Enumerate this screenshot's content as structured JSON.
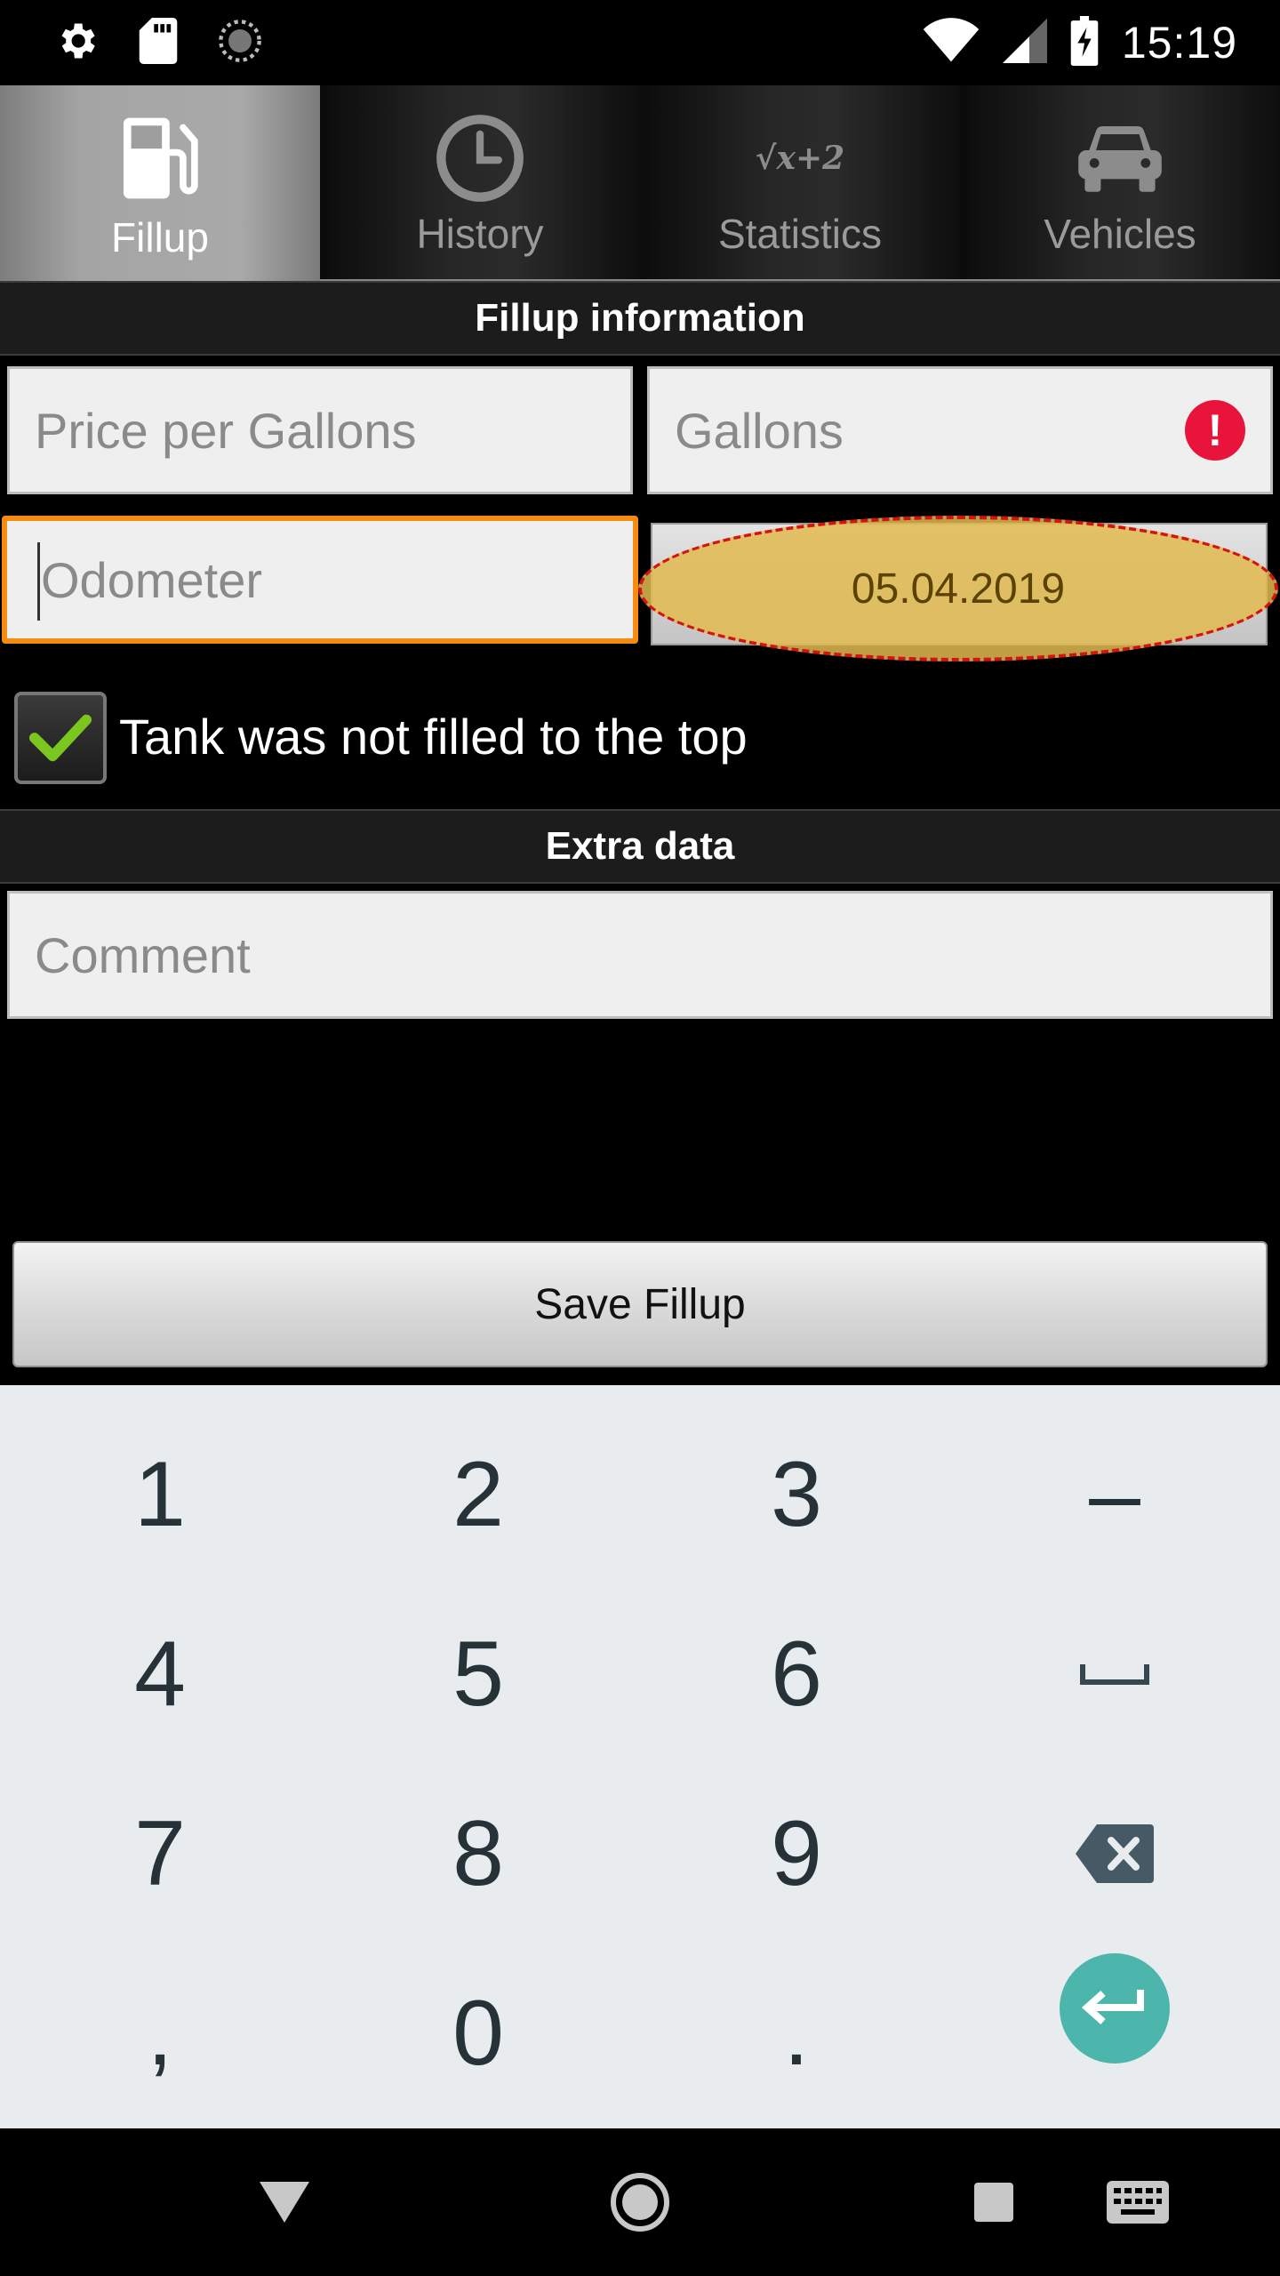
{
  "status_bar": {
    "time": "15:19",
    "icons": [
      "settings-icon",
      "sd-card-icon",
      "loading-icon",
      "wifi-icon",
      "signal-icon",
      "battery-charging-icon"
    ]
  },
  "tabs": [
    {
      "label": "Fillup",
      "icon": "fuel-pump-icon",
      "active": true
    },
    {
      "label": "History",
      "icon": "clock-icon",
      "active": false
    },
    {
      "label": "Statistics",
      "icon": "formula-icon",
      "icon_text": "√x+2",
      "active": false
    },
    {
      "label": "Vehicles",
      "icon": "car-icon",
      "active": false
    }
  ],
  "fillup_section": {
    "title": "Fillup information",
    "price_placeholder": "Price per Gallons",
    "gallons_placeholder": "Gallons",
    "gallons_error_icon": "!",
    "odometer_placeholder": "Odometer",
    "date": "05.04.2019"
  },
  "tank_checkbox": {
    "label": "Tank was not filled to the top",
    "checked": true
  },
  "extra_section": {
    "title": "Extra data",
    "comment_placeholder": "Comment"
  },
  "save_button": "Save Fillup",
  "keyboard": {
    "rows": [
      [
        "1",
        "2",
        "3",
        "–"
      ],
      [
        "4",
        "5",
        "6",
        "space"
      ],
      [
        "7",
        "8",
        "9",
        "backspace"
      ],
      [
        ",",
        "0",
        ".",
        "enter"
      ]
    ],
    "enter_color": "#4db6ac"
  },
  "nav_bar": [
    "back-icon",
    "home-icon",
    "recents-icon",
    "keyboard-switch-icon"
  ],
  "colors": {
    "focus_border": "#f58b10",
    "error": "#e8143b",
    "check": "#7cc71f"
  }
}
